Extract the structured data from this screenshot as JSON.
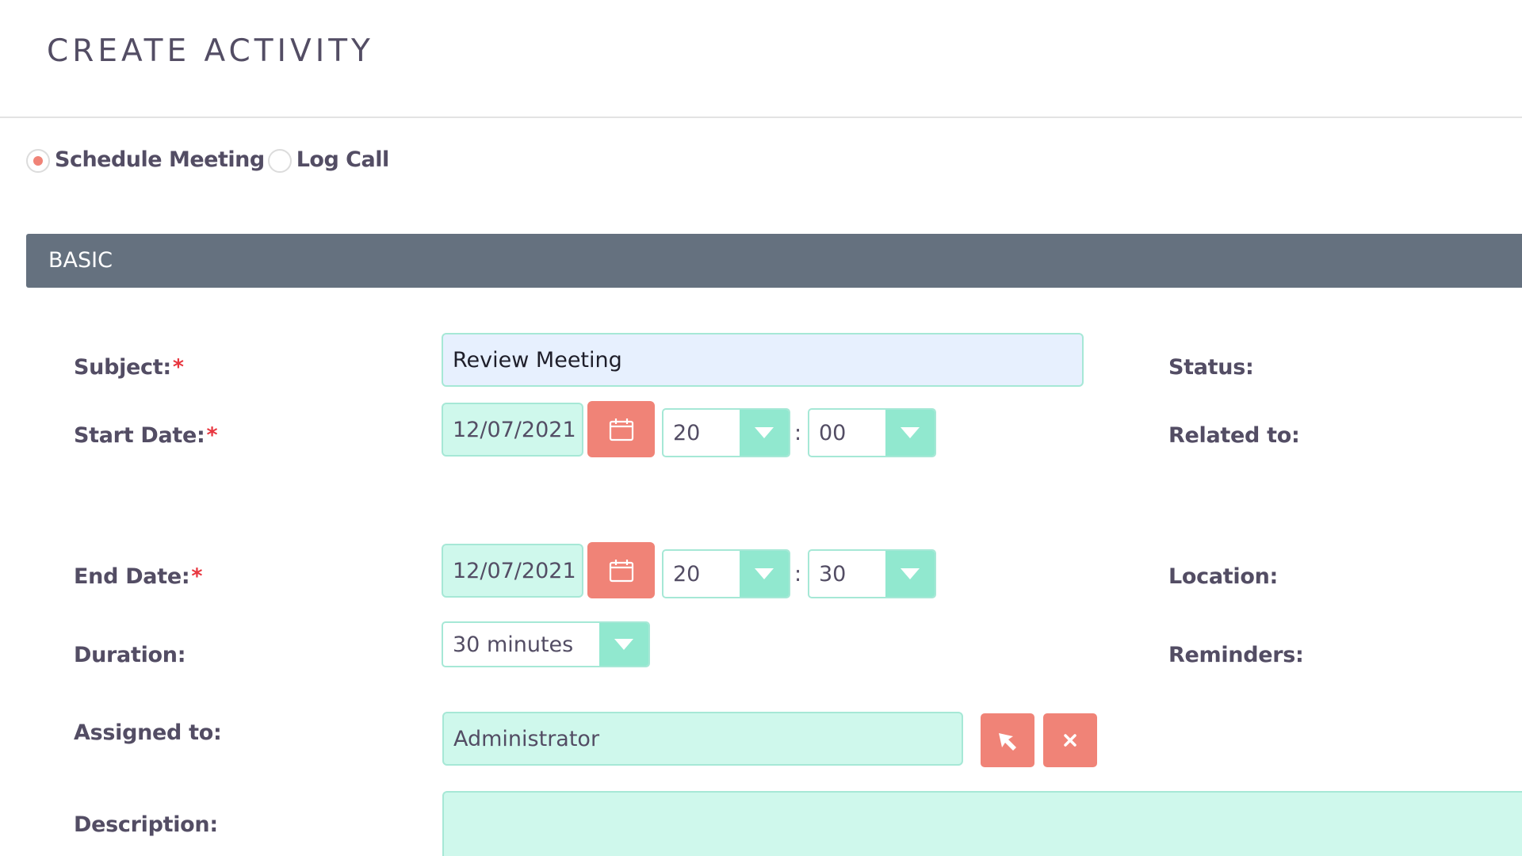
{
  "page": {
    "title": "CREATE ACTIVITY"
  },
  "activity_type": {
    "options": [
      {
        "label": "Schedule Meeting",
        "checked": true
      },
      {
        "label": "Log Call",
        "checked": false
      }
    ]
  },
  "panel": {
    "title": "BASIC"
  },
  "form": {
    "subject": {
      "label": "Subject:",
      "required_mark": "*",
      "value": "Review Meeting"
    },
    "start_date": {
      "label": "Start Date:",
      "required_mark": "*",
      "date": "12/07/2021",
      "hour": "20",
      "minute": "00",
      "separator": ":"
    },
    "end_date": {
      "label": "End Date:",
      "required_mark": "*",
      "date": "12/07/2021",
      "hour": "20",
      "minute": "30",
      "separator": ":"
    },
    "duration": {
      "label": "Duration:",
      "value": "30 minutes"
    },
    "assigned_to": {
      "label": "Assigned to:",
      "value": "Administrator"
    },
    "description": {
      "label": "Description:",
      "value": ""
    }
  },
  "right_column": {
    "status_label": "Status:",
    "related_label": "Related to:",
    "location_label": "Location:",
    "reminders_label": "Reminders:"
  },
  "icons": {
    "calendar": "calendar-icon",
    "dropdown": "chevron-down-icon",
    "select": "select-arrow-cursor-icon",
    "clear": "close-icon"
  },
  "colors": {
    "accent": "#f08377",
    "field_bg": "#cff8ec",
    "field_border": "#a6e8d6",
    "dropdown_bg": "#91e8cf",
    "header_bg": "#65717f",
    "text": "#534d64",
    "required": "#e8363f"
  }
}
